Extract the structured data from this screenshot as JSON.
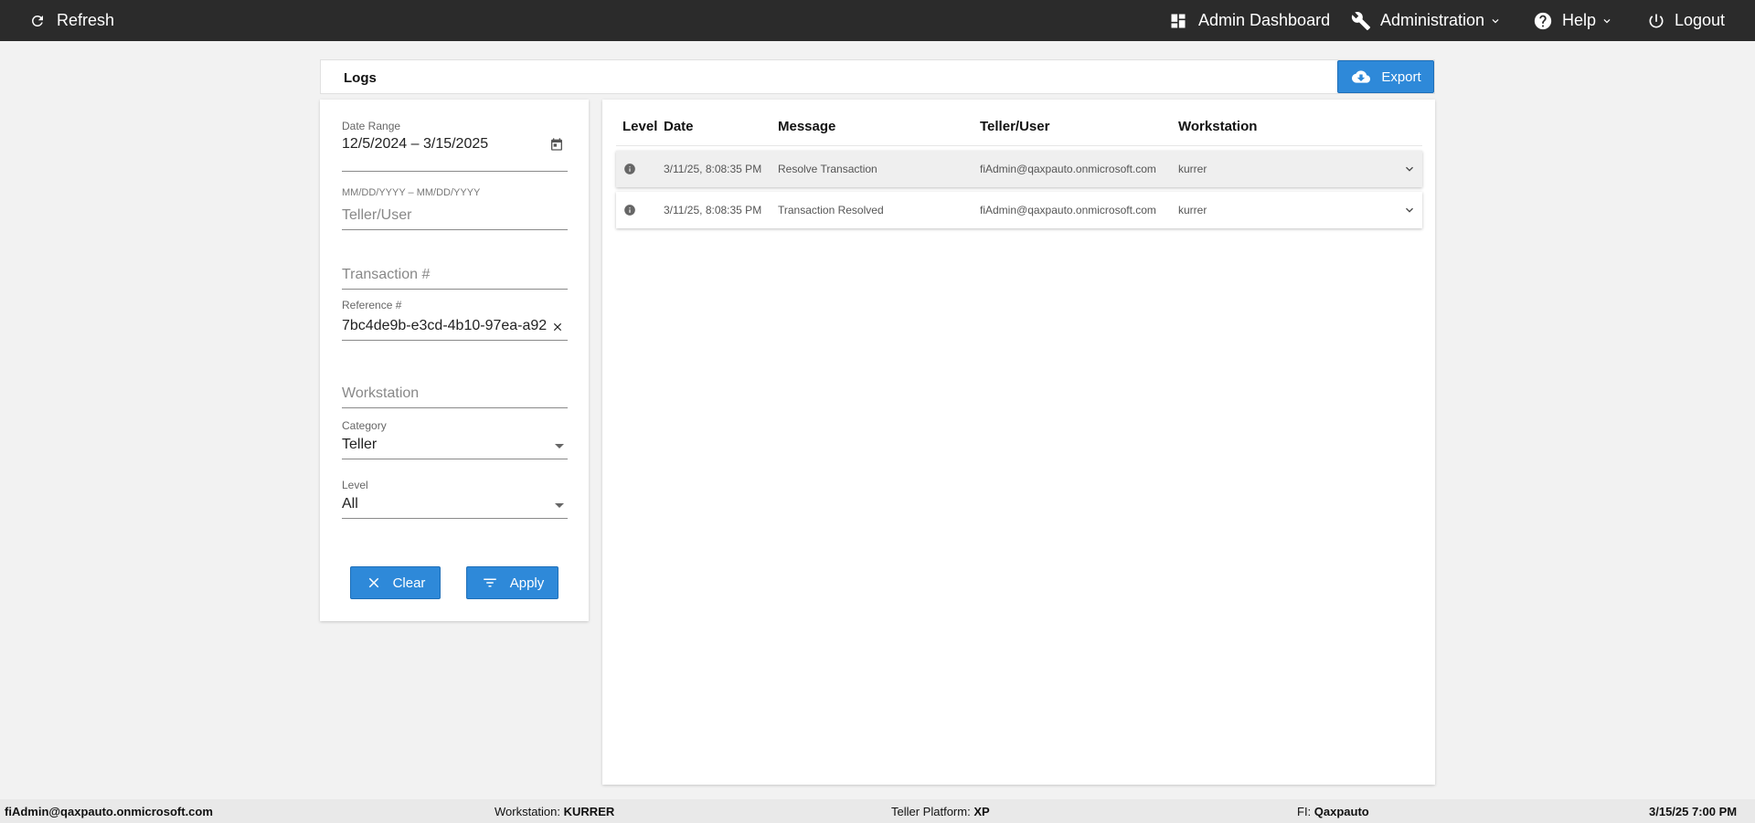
{
  "topbar": {
    "refresh_label": "Refresh",
    "dashboard_label": "Admin Dashboard",
    "administration_label": "Administration",
    "help_label": "Help",
    "logout_label": "Logout"
  },
  "page": {
    "title": "Logs",
    "export_label": "Export"
  },
  "filters": {
    "date_range": {
      "label": "Date Range",
      "value": "12/5/2024 – 3/15/2025",
      "hint": "MM/DD/YYYY – MM/DD/YYYY"
    },
    "teller_user": {
      "placeholder": "Teller/User"
    },
    "transaction": {
      "placeholder": "Transaction #"
    },
    "reference": {
      "label": "Reference #",
      "value": "7bc4de9b-e3cd-4b10-97ea-a92"
    },
    "workstation": {
      "placeholder": "Workstation"
    },
    "category": {
      "label": "Category",
      "value": "Teller"
    },
    "level": {
      "label": "Level",
      "value": "All"
    },
    "clear_label": "Clear",
    "apply_label": "Apply"
  },
  "table": {
    "headers": {
      "level": "Level",
      "date": "Date",
      "message": "Message",
      "user": "Teller/User",
      "workstation": "Workstation"
    },
    "rows": [
      {
        "level_icon": "info-icon",
        "date": "3/11/25, 8:08:35 PM",
        "message": "Resolve Transaction",
        "user": "fiAdmin@qaxpauto.onmicrosoft.com",
        "workstation": "kurrer"
      },
      {
        "level_icon": "info-icon",
        "date": "3/11/25, 8:08:35 PM",
        "message": "Transaction Resolved",
        "user": "fiAdmin@qaxpauto.onmicrosoft.com",
        "workstation": "kurrer"
      }
    ]
  },
  "statusbar": {
    "user": "fiAdmin@qaxpauto.onmicrosoft.com",
    "workstation_label": "Workstation:",
    "workstation_value": "KURRER",
    "platform_label": "Teller Platform:",
    "platform_value": "XP",
    "fi_label": "FI:",
    "fi_value": "Qaxpauto",
    "datetime": "3/15/25 7:00 PM"
  },
  "colors": {
    "topbar": "#2b2b2b",
    "accent": "#2e89d9",
    "background": "#f2f2f2"
  }
}
